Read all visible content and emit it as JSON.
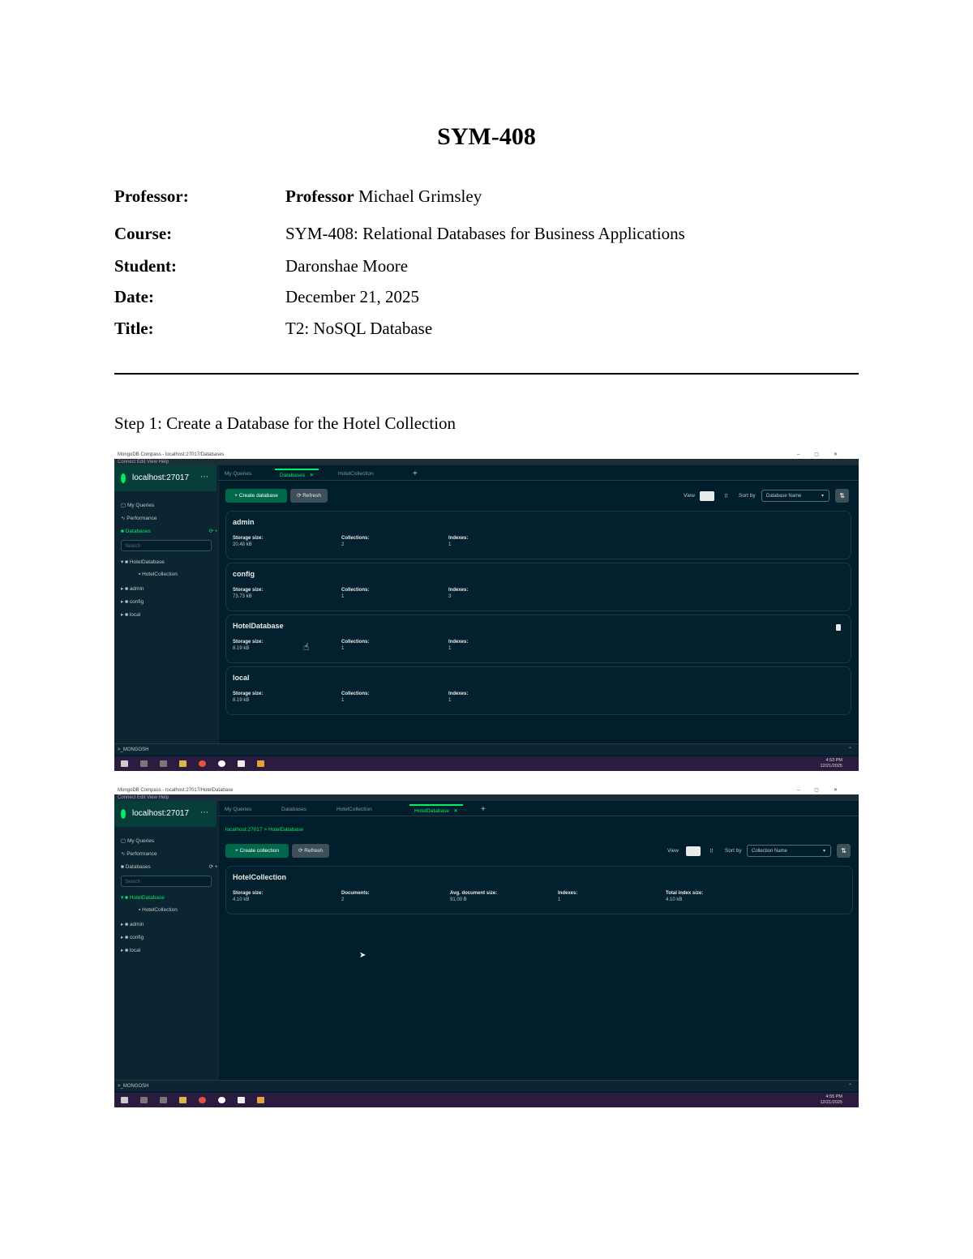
{
  "document": {
    "title": "SYM-408",
    "meta": [
      {
        "key": "Professor:",
        "value_bold": "Professor",
        "value": "Michael Grimsley"
      },
      {
        "key": "Course:",
        "value": "SYM-408: Relational Databases for Business Applications"
      },
      {
        "key": "Student:",
        "value": "Daronshae Moore"
      },
      {
        "key": "Date:",
        "value": "December 21, 2025"
      },
      {
        "key": "Title:",
        "value": "T2: NoSQL Database"
      }
    ],
    "step1": "Step 1: Create a Database for the Hotel Collection"
  },
  "shot1": {
    "window_title": "MongoDB Compass - localhost:27017/Databases",
    "menu": "Connect  Edit  View  Help",
    "connection": "localhost:27017",
    "sidebar": {
      "my_queries": "My Queries",
      "performance": "Performance",
      "databases": "Databases",
      "search_placeholder": "Search",
      "db_items": [
        "HotelDatabase",
        "HotelCollection",
        "admin",
        "config",
        "local"
      ]
    },
    "tabs": [
      "My Queries",
      "Databases",
      "HotelCollection"
    ],
    "buttons": {
      "create": "+ Create database",
      "refresh": "⟳ Refresh"
    },
    "view_label": "View",
    "sort_label": "Sort by",
    "sort_value": "Database Name",
    "cards": [
      {
        "name": "admin",
        "storage_label": "Storage size:",
        "storage": "20.48 kB",
        "coll_label": "Collections:",
        "coll": "2",
        "idx_label": "Indexes:",
        "idx": "1"
      },
      {
        "name": "config",
        "storage_label": "Storage size:",
        "storage": "73.73 kB",
        "coll_label": "Collections:",
        "coll": "1",
        "idx_label": "Indexes:",
        "idx": "3"
      },
      {
        "name": "HotelDatabase",
        "storage_label": "Storage size:",
        "storage": "8.19 kB",
        "coll_label": "Collections:",
        "coll": "1",
        "idx_label": "Indexes:",
        "idx": "1"
      },
      {
        "name": "local",
        "storage_label": "Storage size:",
        "storage": "8.19 kB",
        "coll_label": "Collections:",
        "coll": "1",
        "idx_label": "Indexes:",
        "idx": "1"
      }
    ],
    "shell": ">_MONGOSH",
    "clock": "4:53 PM\n12/21/2025"
  },
  "shot2": {
    "window_title": "MongoDB Compass - localhost:27017/HotelDatabase",
    "menu": "Connect  Edit  View  Help",
    "connection": "localhost:27017",
    "sidebar": {
      "my_queries": "My Queries",
      "performance": "Performance",
      "databases": "Databases",
      "search_placeholder": "Search",
      "db_items": [
        "HotelDatabase",
        "HotelCollection",
        "admin",
        "config",
        "local"
      ]
    },
    "tabs": [
      "My Queries",
      "Databases",
      "HotelCollection",
      "HotelDatabase"
    ],
    "breadcrumb": "localhost:27017 > HotelDatabase",
    "buttons": {
      "create": "+ Create collection",
      "refresh": "⟳ Refresh"
    },
    "view_label": "View",
    "sort_label": "Sort by",
    "sort_value": "Collection Name",
    "card": {
      "name": "HotelCollection",
      "storage_label": "Storage size:",
      "storage": "4.10 kB",
      "docs_label": "Documents:",
      "docs": "2",
      "avg_label": "Avg. document size:",
      "avg": "91.00 B",
      "idx_label": "Indexes:",
      "idx": "1",
      "tis_label": "Total index size:",
      "tis": "4.10 kB"
    },
    "shell": ">_MONGOSH",
    "clock": "4:55 PM\n12/21/2025"
  },
  "colors": {
    "accent": "#00ed64",
    "bg": "#001e2b",
    "button": "#00684a",
    "taskbar": "#2b1b3f"
  }
}
